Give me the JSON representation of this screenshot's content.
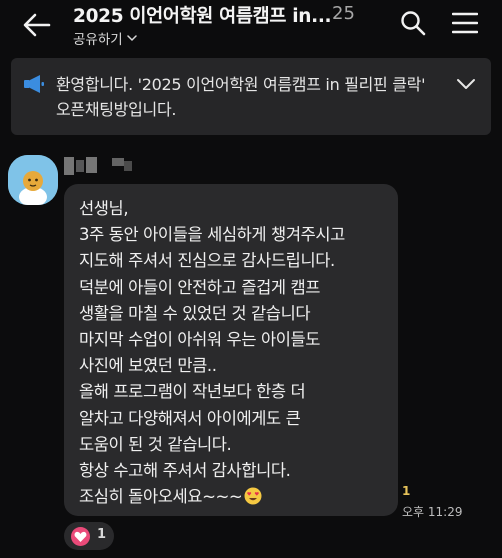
{
  "header": {
    "title": "2025 이언어학원 여름캠프 in...",
    "member_count": "25",
    "subtitle": "공유하기",
    "icons": [
      "back-arrow-icon",
      "chevron-down-icon",
      "search-icon",
      "hamburger-menu-icon"
    ]
  },
  "notice": {
    "icon": "megaphone-icon",
    "text": "환영합니다. '2025 이언어학원 여름캠프 in 필리핀 클락' 오픈채팅방입니다.",
    "toggle_icon": "chevron-down-icon"
  },
  "message": {
    "lines": [
      "선생님,",
      "3주 동안 아이들을 세심하게 챙겨주시고",
      "지도해 주셔서 진심으로 감사드립니다.",
      "덕분에 아들이 안전하고 즐겁게 캠프",
      "생활을 마칠 수 있었던 것 같습니다",
      "마지막 수업이 아쉬워 우는 아이들도",
      "사진에 보였던 만큼..",
      "올해 프로그램이 작년보다 한층 더",
      "알차고 다양해져서 아이에게도 큰",
      "도움이 된 것 같습니다.",
      "항상 수고해 주셔서 감사합니다.",
      "조심히 돌아오세요~~~"
    ],
    "emoji": "heart-eyes-emoji",
    "unread_count": "1",
    "time": "오후 11:29"
  },
  "reaction": {
    "icon": "heart-icon",
    "count": "1"
  },
  "colors": {
    "background": "#0c0c0d",
    "bubble": "#2a2a2c",
    "notice_bg": "#262628",
    "notice_icon": "#3b8de0",
    "unread": "#e7c35a",
    "reaction": "#ea4a79"
  }
}
